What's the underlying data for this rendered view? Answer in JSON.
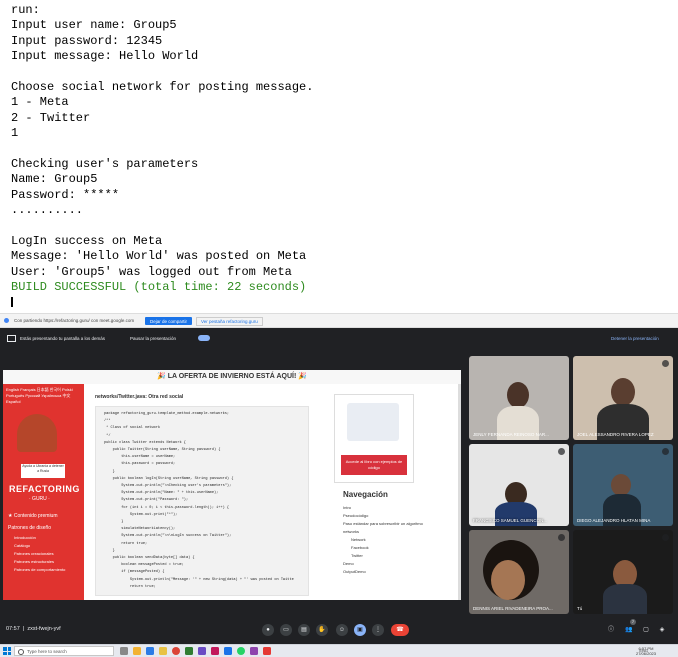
{
  "console": {
    "lines": [
      "run:",
      "Input user name: Group5",
      "Input password: 12345",
      "Input message: Hello World",
      "",
      "Choose social network for posting message.",
      "1 - Meta",
      "2 - Twitter",
      "1",
      "",
      "Checking user's parameters",
      "Name: Group5",
      "Password: *****",
      "..........",
      "",
      "LogIn success on Meta",
      "Message: 'Hello World' was posted on Meta",
      "User: 'Group5' was logged out from Meta"
    ],
    "build_line": "BUILD SUCCESSFUL (total time: 22 seconds)",
    "colors": {
      "success": "#2e8b1f"
    }
  },
  "share_bar": {
    "text": "Con partiendo https://refactoring.guru/ con meet.google.com",
    "stop_button": "Dejar de compartir",
    "share_this": "Ver pestaña refactoring.guru"
  },
  "meet": {
    "banner_text": "Estás presentando tu pantalla a los demás",
    "pause_text": "Pausar la presentación",
    "stop_presenting": "Detener la presentación",
    "meeting_time": "07:57",
    "meeting_code": "zxst-fwejn-yvf",
    "people_count": "7",
    "participants": [
      {
        "name": "JENLY FERNANDA REINOSO NAR..."
      },
      {
        "name": "JOEL ALESSANDRO RIVERA LOPEZ"
      },
      {
        "name": "FRANCISCO SAMUEL GUENCON..."
      },
      {
        "name": "DIEGO ALEJANDRO HLATAN MINA"
      },
      {
        "name": "DENNIS ARIEL RIVADENEIRA PROA..."
      },
      {
        "name": "Tú"
      }
    ],
    "colors": {
      "bg": "#202124",
      "tile": "#3c4043",
      "accent": "#8ab4f8",
      "end_call": "#ea4335"
    }
  },
  "shared_page": {
    "promo": "🎉 LA OFERTA DE INVIERNO ESTÁ AQUÍ! 🎉",
    "langs": "English  Français  日本語  한국어  Polski  Português  Русский  Українська  中文  Español",
    "ukraine": "Ayuda a Ukrania a detener a Rusia",
    "brand": "REFACTORING",
    "brand_sub": "· GURU ·",
    "menu": {
      "premium": "★ Contenido premium",
      "patterns": "Patrones de diseño",
      "intro": "Introducción",
      "catalog": "Catálogo",
      "sub": [
        "Patrones creacionales",
        "Patrones estructurales",
        "Patrones de comportamiento"
      ]
    },
    "code_title": "networks/Twitter.java: Otra red social",
    "code_lines": [
      "package refactoring_guru.template_method.example.networks;",
      "",
      "/**",
      " * Class of social network",
      " */",
      "public class Twitter extends Network {",
      "",
      "    public Twitter(String userName, String password) {",
      "        this.userName = userName;",
      "        this.password = password;",
      "    }",
      "",
      "    public boolean logIn(String userName, String password) {",
      "        System.out.println(\"\\nChecking user's parameters\");",
      "        System.out.println(\"Name: \" + this.userName);",
      "        System.out.print(\"Password: \");",
      "        for (int i = 0; i < this.password.length(); i++) {",
      "            System.out.print(\"*\");",
      "        }",
      "        simulateNetworkLatency();",
      "        System.out.println(\"\\n\\nLogIn success on Twitter\");",
      "        return true;",
      "    }",
      "",
      "    public boolean sendData(byte[] data) {",
      "        boolean messagePosted = true;",
      "        if (messagePosted) {",
      "            System.out.println(\"Message: '\" + new String(data) + \"' was posted on Twitte",
      "            return true;"
    ],
    "promo_card_btn": "Accede al libro con ejemplos de código",
    "nav_title": "Navegación",
    "nav_items": [
      "Intro",
      "Pseudocódigo",
      "Paso estándar para sobrescribir un algoritmo",
      "networks",
      "Network",
      "Facebook",
      "Twitter",
      "Demo",
      "OutputDemo"
    ]
  },
  "taskbar": {
    "search_placeholder": "Type here to search",
    "tray_text": "ENG",
    "clock_time": "6:57 PM",
    "clock_date": "27/06/2023"
  }
}
